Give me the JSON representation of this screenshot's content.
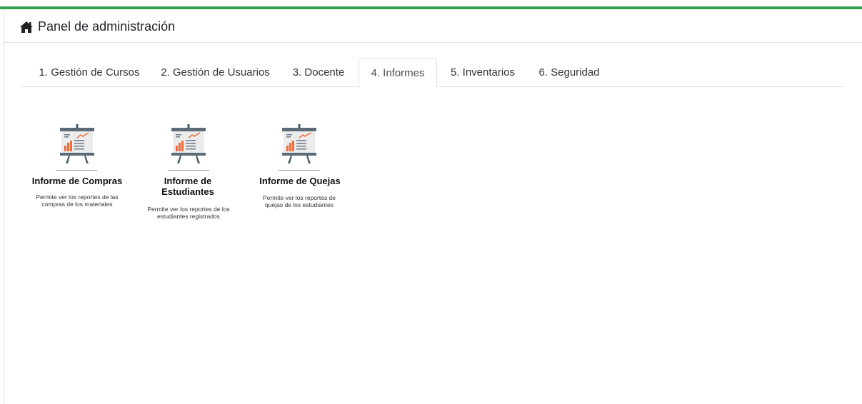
{
  "header": {
    "title": "Panel de administración",
    "icon": "home-icon"
  },
  "tabs": [
    {
      "label": "1. Gestión de Cursos",
      "active": false
    },
    {
      "label": "2. Gestión de Usuarios",
      "active": false
    },
    {
      "label": "3. Docente",
      "active": false
    },
    {
      "label": "4. Informes",
      "active": true
    },
    {
      "label": "5. Inventarios",
      "active": false
    },
    {
      "label": "6. Seguridad",
      "active": false
    }
  ],
  "cards": [
    {
      "title": "Informe de Compras",
      "description": "Permite ver los reportes de las compras de los materiales",
      "icon": "presentation-chart-icon"
    },
    {
      "title": "Informe de Estudiantes",
      "description": "Permite ver los reportes de los estudiantes registrados",
      "icon": "presentation-chart-icon"
    },
    {
      "title": "Informe de Quejas",
      "description": "Permite ver los reportes de quejas de los estudiantes",
      "icon": "presentation-chart-icon"
    }
  ],
  "colors": {
    "accent": "#2ea44f",
    "chart_orange": "#f26b3a",
    "board": "#eeeeee",
    "stand": "#4a5a67"
  }
}
